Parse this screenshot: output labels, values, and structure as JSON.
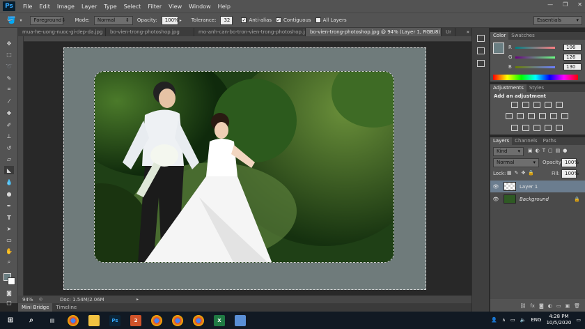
{
  "app": {
    "logo": "Ps",
    "menu": [
      "File",
      "Edit",
      "Image",
      "Layer",
      "Type",
      "Select",
      "Filter",
      "View",
      "Window",
      "Help"
    ],
    "window_controls": [
      "—",
      "❐",
      "✕"
    ]
  },
  "options": {
    "fill_source": "Foreground",
    "mode_label": "Mode:",
    "mode_value": "Normal",
    "opacity_label": "Opacity:",
    "opacity_value": "100%",
    "tolerance_label": "Tolerance:",
    "tolerance_value": "32",
    "anti_alias": "Anti-alias",
    "contiguous": "Contiguous",
    "all_layers": "All Layers",
    "workspace": "Essentials"
  },
  "tabs": [
    "mua-he-uong-nuoc-gi-dep-da.jpg",
    "bo-vien-trong-photoshop.jpg",
    "mo-anh-can-bo-tron-vien-trong-photoshop.jpg",
    "bo-vien-trong-photoshop.jpg @ 94% (Layer 1, RGB/8) *",
    "Ur"
  ],
  "status": {
    "zoom": "94%",
    "doc": "Doc: 1.54M/2.06M"
  },
  "bottom_tabs": [
    "Mini Bridge",
    "Timeline"
  ],
  "color_panel": {
    "tabs": [
      "Color",
      "Swatches"
    ],
    "r_label": "R",
    "g_label": "G",
    "b_label": "B",
    "r": "106",
    "g": "126",
    "b": "130",
    "swatch": "#6a7e82"
  },
  "adjustments": {
    "tabs": [
      "Adjustments",
      "Styles"
    ],
    "title": "Add an adjustment"
  },
  "layers_panel": {
    "tabs": [
      "Layers",
      "Channels",
      "Paths"
    ],
    "kind": "Kind",
    "blend": "Normal",
    "opacity_label": "Opacity:",
    "opacity": "100%",
    "lock_label": "Lock:",
    "fill_label": "Fill:",
    "fill": "100%",
    "layers": [
      "Layer 1",
      "Background"
    ]
  },
  "taskbar": {
    "time": "4:28 PM",
    "date": "10/5/2020",
    "lang": "ENG"
  }
}
